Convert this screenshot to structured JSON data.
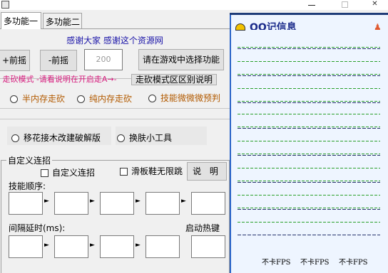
{
  "window": {
    "title_icon": "app-icon",
    "min_glyph": "—",
    "max_glyph": "☐",
    "close_glyph": "✕"
  },
  "tabs": [
    {
      "label": "多功能一",
      "active": true
    },
    {
      "label": "多功能二",
      "active": false
    }
  ],
  "thanks_text": "感谢大家  感谢这个资源网",
  "move": {
    "front_label": "+前摇",
    "back_label": "-前摇",
    "value": "200",
    "select_label": "请在游戏中选择功能"
  },
  "walk": {
    "notice": "- 走砍模式 -请看说明在开启走A→-",
    "diff_button": "走砍模式区区别说明"
  },
  "walk_options": [
    "半内存走砍",
    "纯内存走砍",
    "技能微微微预判"
  ],
  "extra_options": [
    "移花接木改建破解版",
    "换肤小工具"
  ],
  "combo": {
    "legend": "自定义连招",
    "custom_check": "自定义连招",
    "skate_check": "滑板鞋无限跳",
    "help_button": "说 明",
    "order_label": "技能顺序:",
    "delay_label": "间隔延时(ms):",
    "hotkey_label": "启动热键",
    "arrow": "►"
  },
  "qq": {
    "title": "QQ记信息",
    "colors": {
      "accent": "#2a64c8",
      "green_dash": "#2aa02a",
      "navy_dash": "#23306b"
    },
    "fps": [
      "不卡FPS",
      "不卡FPS",
      "不卡FPS"
    ]
  }
}
